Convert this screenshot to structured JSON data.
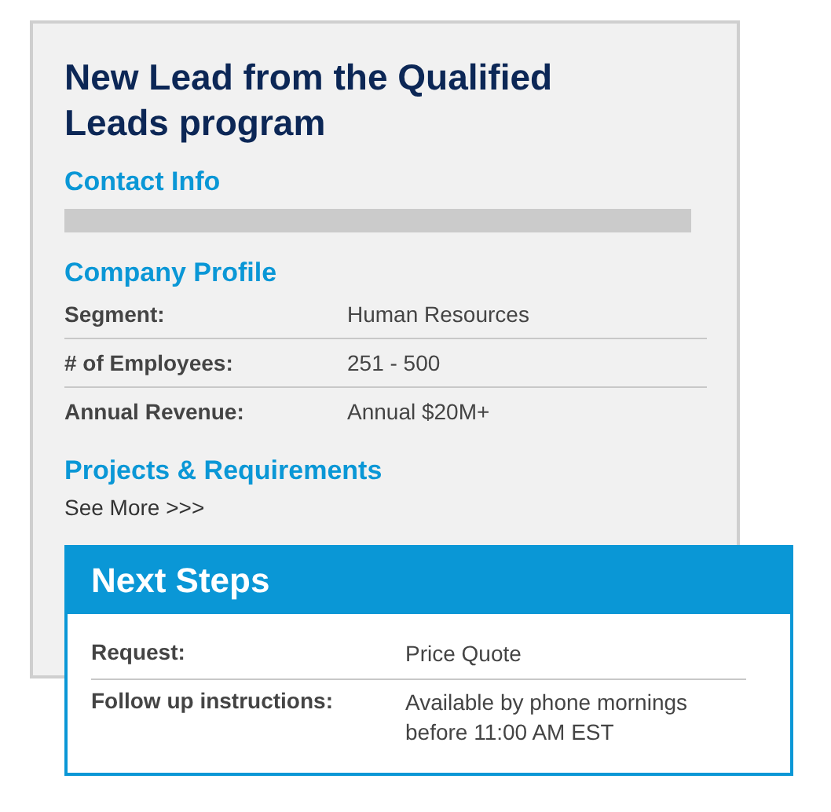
{
  "title": "New Lead from the Qualified Leads program",
  "contact_info": {
    "heading": "Contact Info"
  },
  "company_profile": {
    "heading": "Company Profile",
    "rows": [
      {
        "label": "Segment:",
        "value": "Human Resources"
      },
      {
        "label": "# of Employees:",
        "value": "251 - 500"
      },
      {
        "label": "Annual Revenue:",
        "value": "Annual $20M+"
      }
    ]
  },
  "projects": {
    "heading": "Projects & Requirements",
    "link": "See More >>>"
  },
  "next_steps": {
    "heading": "Next Steps",
    "rows": [
      {
        "label": "Request:",
        "value": "Price Quote"
      },
      {
        "label": "Follow up instructions:",
        "value": "Available by phone mornings before 11:00 AM EST"
      }
    ]
  }
}
